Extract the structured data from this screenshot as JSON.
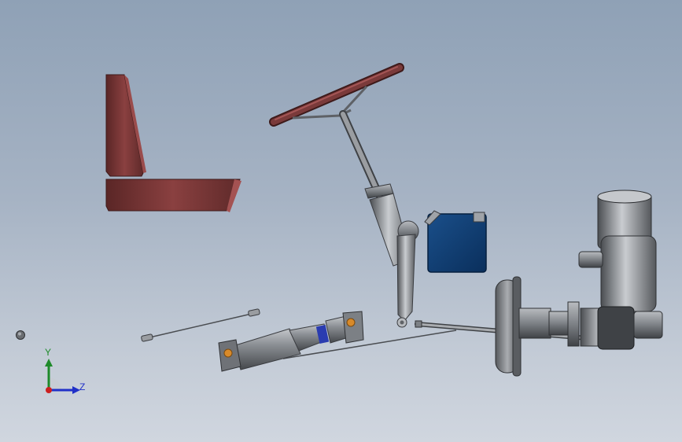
{
  "viewport": {
    "background_top": "#8fa1b6",
    "background_bottom": "#d0d6df"
  },
  "model": {
    "parts": [
      {
        "name": "seat",
        "color": "#7a3a3a"
      },
      {
        "name": "steering-wheel",
        "color": "#7a3a3a"
      },
      {
        "name": "steering-column",
        "color": "#8a8d91"
      },
      {
        "name": "steering-gear-box",
        "color": "#0d3c70"
      },
      {
        "name": "drive-shaft",
        "color": "#7c8085"
      },
      {
        "name": "brake-drum",
        "color": "#6f7276"
      },
      {
        "name": "engine-housing",
        "color": "#7d8084"
      },
      {
        "name": "tie-rod",
        "color": "#9a9da1"
      }
    ]
  },
  "triad": {
    "y_label": "Y",
    "z_label": "Z",
    "y_color": "#1e8a2a",
    "z_color": "#2030c8",
    "x_color": "#cc2020"
  }
}
